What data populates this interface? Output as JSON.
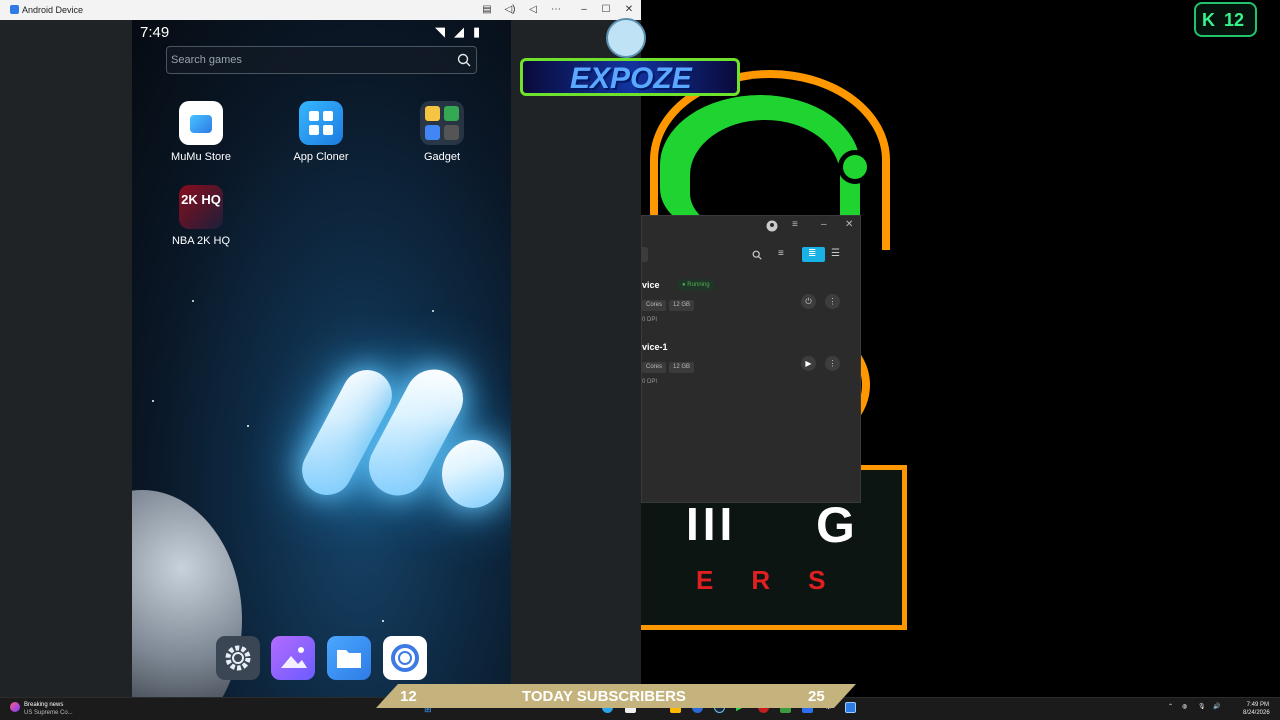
{
  "emulator": {
    "window_title": "Android Device",
    "status_time": "7:49",
    "search_placeholder": "Search games",
    "apps": [
      {
        "label": "MuMu Store",
        "icon": "mumu-store-icon"
      },
      {
        "label": "App Cloner",
        "icon": "app-cloner-icon"
      },
      {
        "label": "Gadget",
        "icon": "gadget-folder-icon"
      },
      {
        "label": "NBA 2K HQ",
        "icon": "nba-2k-hq-icon"
      }
    ],
    "nba_icon_text": "2K HQ",
    "dock": [
      "settings-icon",
      "gallery-icon",
      "files-icon",
      "browser-icon"
    ]
  },
  "manager": {
    "devices": [
      {
        "name": "vice",
        "status": "Running",
        "cores": "Cores",
        "ram": "12 GB",
        "dpi": "0 DPI"
      },
      {
        "name": "vice-1",
        "status": "",
        "cores": "Cores",
        "ram": "12 GB",
        "dpi": "0 DPI"
      }
    ]
  },
  "overlay": {
    "expoze_banner": "EXPOZE",
    "k_badge_letter": "K",
    "k_badge_number": "12",
    "subs_left": "12",
    "subs_label": "TODAY SUBSCRIBERS",
    "subs_right": "25",
    "logo_letters": "ERS",
    "logo_big": "G"
  },
  "taskbar": {
    "news_title": "Breaking news",
    "news_sub": "US Supreme Co...",
    "time": "7:49 PM",
    "date": "8/24/2026"
  },
  "colors": {
    "accent_blue": "#2f9fe8",
    "running_green": "#4caf50",
    "logo_orange": "#ff9800",
    "logo_green": "#1fd430",
    "logo_red": "#e02020"
  }
}
